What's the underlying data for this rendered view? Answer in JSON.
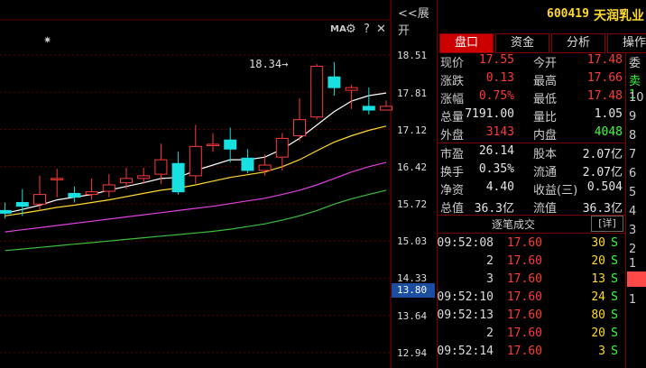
{
  "chart_toolbar": {
    "expand": "<<展开",
    "ma": "MA",
    "settings_icon": "gear-icon",
    "help": "?",
    "close": "✕"
  },
  "price_axis": [
    "18.51",
    "17.81",
    "17.12",
    "16.42",
    "15.72",
    "15.03",
    "14.33",
    "13.64",
    "12.94"
  ],
  "current_price_marker": "13.80",
  "annotation_high": "18.34→",
  "chart_data": {
    "type": "candlestick",
    "candles": [
      {
        "o": 15.55,
        "c": 15.6,
        "h": 15.75,
        "l": 15.45,
        "up": false
      },
      {
        "o": 15.75,
        "c": 15.68,
        "h": 16.0,
        "l": 15.5,
        "up": false
      },
      {
        "o": 15.72,
        "c": 15.9,
        "h": 16.25,
        "l": 15.6,
        "up": true
      },
      {
        "o": 16.18,
        "c": 16.2,
        "h": 16.38,
        "l": 15.85,
        "up": true
      },
      {
        "o": 15.92,
        "c": 15.85,
        "h": 16.05,
        "l": 15.75,
        "up": false
      },
      {
        "o": 15.9,
        "c": 15.95,
        "h": 16.2,
        "l": 15.8,
        "up": true
      },
      {
        "o": 15.96,
        "c": 16.08,
        "h": 16.28,
        "l": 15.85,
        "up": true
      },
      {
        "o": 16.12,
        "c": 16.2,
        "h": 16.4,
        "l": 16.0,
        "up": true
      },
      {
        "o": 16.2,
        "c": 16.25,
        "h": 16.4,
        "l": 16.1,
        "up": true
      },
      {
        "o": 16.28,
        "c": 16.55,
        "h": 16.85,
        "l": 16.1,
        "up": true
      },
      {
        "o": 16.48,
        "c": 15.95,
        "h": 16.7,
        "l": 15.9,
        "up": false
      },
      {
        "o": 16.25,
        "c": 16.8,
        "h": 17.2,
        "l": 16.1,
        "up": true
      },
      {
        "o": 16.82,
        "c": 16.84,
        "h": 17.05,
        "l": 16.7,
        "up": true
      },
      {
        "o": 16.92,
        "c": 16.75,
        "h": 17.15,
        "l": 16.5,
        "up": false
      },
      {
        "o": 16.58,
        "c": 16.35,
        "h": 16.75,
        "l": 16.3,
        "up": false
      },
      {
        "o": 16.35,
        "c": 16.45,
        "h": 16.65,
        "l": 16.25,
        "up": true
      },
      {
        "o": 16.6,
        "c": 16.95,
        "h": 17.05,
        "l": 16.35,
        "up": true
      },
      {
        "o": 17.0,
        "c": 17.3,
        "h": 17.7,
        "l": 16.9,
        "up": true
      },
      {
        "o": 17.35,
        "c": 18.3,
        "h": 18.34,
        "l": 17.3,
        "up": true
      },
      {
        "o": 18.1,
        "c": 17.9,
        "h": 18.38,
        "l": 17.75,
        "up": false
      },
      {
        "o": 17.85,
        "c": 17.9,
        "h": 17.95,
        "l": 17.5,
        "up": true
      },
      {
        "o": 17.55,
        "c": 17.48,
        "h": 17.9,
        "l": 17.4,
        "up": false
      },
      {
        "o": 17.48,
        "c": 17.55,
        "h": 17.66,
        "l": 17.48,
        "up": true
      }
    ],
    "ma_lines": [
      {
        "color": "#ffffff",
        "values": [
          15.55,
          15.62,
          15.7,
          15.8,
          15.85,
          15.9,
          15.98,
          16.05,
          16.12,
          16.2,
          16.22,
          16.35,
          16.45,
          16.55,
          16.55,
          16.6,
          16.75,
          16.95,
          17.2,
          17.45,
          17.65,
          17.75,
          17.8
        ]
      },
      {
        "color": "#ffd92f",
        "values": [
          15.5,
          15.55,
          15.6,
          15.66,
          15.7,
          15.75,
          15.8,
          15.86,
          15.92,
          15.98,
          16.02,
          16.08,
          16.15,
          16.22,
          16.27,
          16.32,
          16.42,
          16.55,
          16.72,
          16.88,
          17.0,
          17.1,
          17.18
        ]
      },
      {
        "color": "#e040e0",
        "values": [
          15.2,
          15.24,
          15.28,
          15.32,
          15.36,
          15.4,
          15.44,
          15.48,
          15.52,
          15.56,
          15.6,
          15.64,
          15.68,
          15.73,
          15.78,
          15.83,
          15.9,
          15.98,
          16.08,
          16.2,
          16.32,
          16.42,
          16.5
        ]
      },
      {
        "color": "#3cbf3c",
        "values": [
          14.85,
          14.88,
          14.91,
          14.94,
          14.97,
          15.0,
          15.03,
          15.06,
          15.09,
          15.12,
          15.15,
          15.18,
          15.21,
          15.25,
          15.3,
          15.35,
          15.42,
          15.5,
          15.6,
          15.72,
          15.82,
          15.9,
          15.98
        ]
      }
    ],
    "ylim": [
      12.94,
      18.51
    ]
  },
  "stock": {
    "code": "600419",
    "name": "天润乳业"
  },
  "tabs": [
    "盘口",
    "资金",
    "分析",
    "操作"
  ],
  "quote": [
    {
      "l1": "现价",
      "v1": "17.55",
      "c1": "red",
      "l2": "今开",
      "v2": "17.48",
      "c2": "red"
    },
    {
      "l1": "涨跌",
      "v1": "0.13",
      "c1": "red",
      "l2": "最高",
      "v2": "17.66",
      "c2": "red"
    },
    {
      "l1": "涨幅",
      "v1": "0.75%",
      "c1": "red",
      "l2": "最低",
      "v2": "17.48",
      "c2": "red"
    },
    {
      "l1": "总量",
      "v1": "7191.00",
      "c1": "white",
      "l2": "量比",
      "v2": "1.05",
      "c2": "white"
    },
    {
      "l1": "外盘",
      "v1": "3143",
      "c1": "red",
      "l2": "内盘",
      "v2": "4048",
      "c2": "green"
    }
  ],
  "fund": [
    {
      "l1": "市盈",
      "v1": "26.14",
      "l2": "股本",
      "v2": "2.07亿"
    },
    {
      "l1": "换手",
      "v1": "0.35%",
      "l2": "流通",
      "v2": "2.07亿"
    },
    {
      "l1": "净资",
      "v1": "4.40",
      "l2": "收益(三)",
      "v2": "0.504"
    },
    {
      "l1": "总值",
      "v1": "36.3亿",
      "l2": "流值",
      "v2": "36.3亿"
    }
  ],
  "side_labels": [
    "委",
    "卖1",
    "10",
    "9",
    "8",
    "7",
    "6",
    "5",
    "4",
    "3",
    "2",
    "1",
    "1"
  ],
  "trades_title": "逐笔成交",
  "trades_detail": "[详]",
  "trades": [
    {
      "time": "09:52:08",
      "price": "17.60",
      "vol": "30",
      "side": "S"
    },
    {
      "time": "2",
      "price": "17.60",
      "vol": "20",
      "side": "S"
    },
    {
      "time": "3",
      "price": "17.60",
      "vol": "13",
      "side": "S"
    },
    {
      "time": "09:52:10",
      "price": "17.60",
      "vol": "24",
      "side": "S"
    },
    {
      "time": "09:52:13",
      "price": "17.60",
      "vol": "80",
      "side": "S"
    },
    {
      "time": "2",
      "price": "17.60",
      "vol": "20",
      "side": "S"
    },
    {
      "time": "09:52:14",
      "price": "17.60",
      "vol": "3",
      "side": "S"
    }
  ]
}
